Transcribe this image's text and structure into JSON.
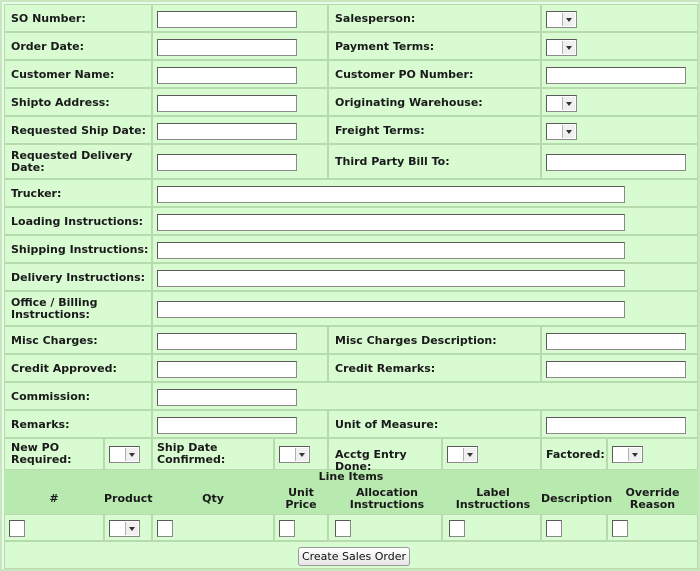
{
  "fields": {
    "so_number": "SO Number:",
    "salesperson": "Salesperson:",
    "order_date": "Order Date:",
    "payment_terms": "Payment Terms:",
    "customer_name": "Customer Name:",
    "customer_po_number": "Customer PO Number:",
    "shipto_address": "Shipto Address:",
    "originating_warehouse": "Originating Warehouse:",
    "requested_ship_date": "Requested Ship Date:",
    "freight_terms": "Freight Terms:",
    "requested_delivery_date": "Requested Delivery Date:",
    "third_party_bill_to": "Third Party Bill To:",
    "trucker": "Trucker:",
    "loading_instructions": "Loading Instructions:",
    "shipping_instructions": "Shipping Instructions:",
    "delivery_instructions": "Delivery Instructions:",
    "office_billing_instructions": "Office / Billing Instructions:",
    "misc_charges": "Misc Charges:",
    "misc_charges_description": "Misc Charges Description:",
    "credit_approved": "Credit Approved:",
    "credit_remarks": "Credit Remarks:",
    "commission": "Commission:",
    "remarks": "Remarks:",
    "unit_of_measure": "Unit of Measure:",
    "new_po_required": "New PO Required:",
    "ship_date_confirmed": "Ship Date Confirmed:",
    "acctg_entry_done": "Acctg Entry Done:",
    "factored": "Factored:"
  },
  "line_items": {
    "title": "Line Items",
    "columns": [
      "#",
      "Product",
      "Qty",
      "Unit Price",
      "Allocation Instructions",
      "Label Instructions",
      "Description",
      "Override Reason"
    ]
  },
  "actions": {
    "create_label": "Create Sales Order"
  }
}
